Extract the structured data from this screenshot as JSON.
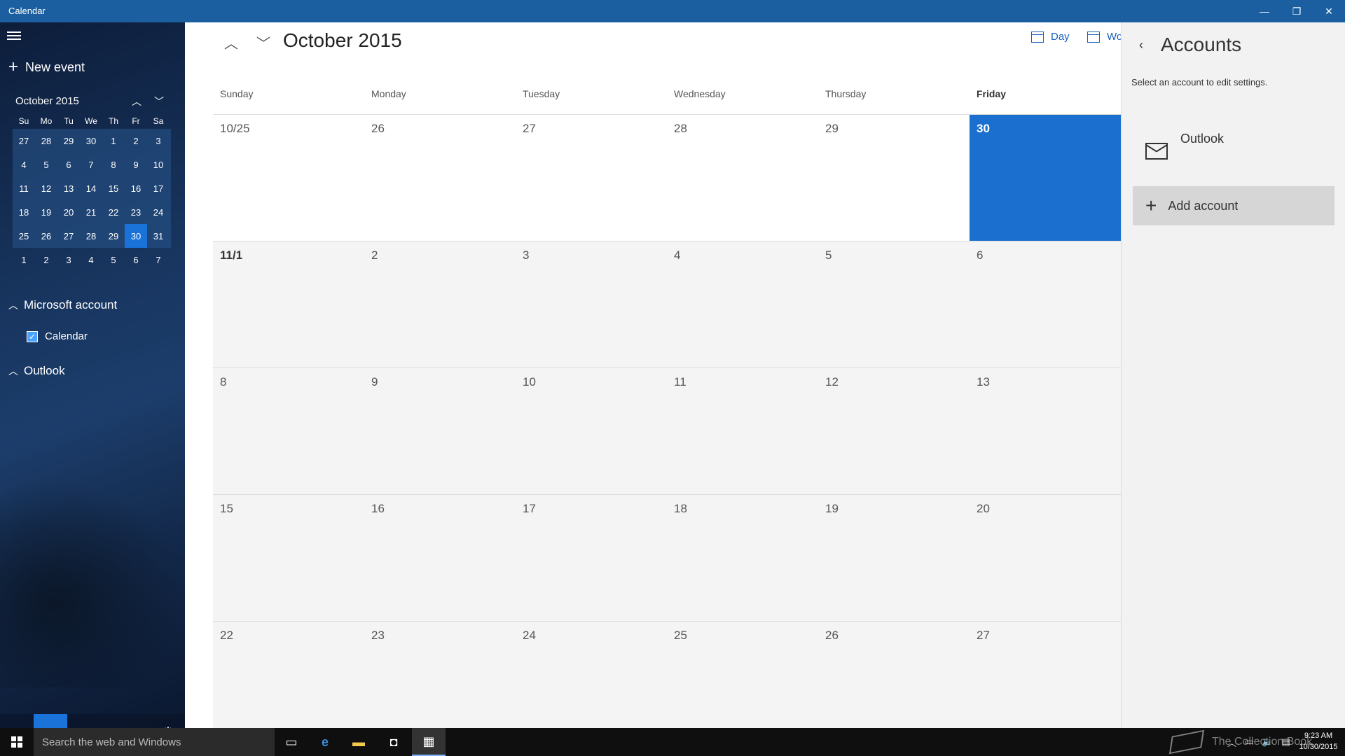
{
  "window": {
    "title": "Calendar",
    "minimize_glyph": "—",
    "maximize_glyph": "❐",
    "close_glyph": "✕"
  },
  "sidebar": {
    "new_event_label": "New event",
    "mini_calendar": {
      "month_label": "October 2015",
      "weekdays": [
        "Su",
        "Mo",
        "Tu",
        "We",
        "Th",
        "Fr",
        "Sa"
      ],
      "weeks": [
        [
          "27",
          "28",
          "29",
          "30",
          "1",
          "2",
          "3"
        ],
        [
          "4",
          "5",
          "6",
          "7",
          "8",
          "9",
          "10"
        ],
        [
          "11",
          "12",
          "13",
          "14",
          "15",
          "16",
          "17"
        ],
        [
          "18",
          "19",
          "20",
          "21",
          "22",
          "23",
          "24"
        ],
        [
          "25",
          "26",
          "27",
          "28",
          "29",
          "30",
          "31"
        ],
        [
          "1",
          "2",
          "3",
          "4",
          "5",
          "6",
          "7"
        ]
      ],
      "today": "30"
    },
    "groups": [
      {
        "label": "Microsoft account",
        "calendars": [
          {
            "label": "Calendar",
            "checked": true
          }
        ]
      },
      {
        "label": "Outlook",
        "calendars": []
      }
    ],
    "bottom_buttons": [
      "mail-icon",
      "calendar-icon",
      "smiley-icon",
      "gear-icon"
    ]
  },
  "main": {
    "month_title": "October 2015",
    "views": [
      {
        "label": "Day",
        "icon": "calendar-day-icon"
      },
      {
        "label": "Wor",
        "icon": "calendar-workweek-icon"
      }
    ],
    "weekdays": [
      "Sunday",
      "Monday",
      "Tuesday",
      "Wednesday",
      "Thursday",
      "Friday"
    ],
    "weeks": [
      [
        "10/25",
        "26",
        "27",
        "28",
        "29",
        "30"
      ],
      [
        "11/1",
        "2",
        "3",
        "4",
        "5",
        "6"
      ],
      [
        "8",
        "9",
        "10",
        "11",
        "12",
        "13"
      ],
      [
        "15",
        "16",
        "17",
        "18",
        "19",
        "20"
      ],
      [
        "22",
        "23",
        "24",
        "25",
        "26",
        "27"
      ]
    ]
  },
  "accounts_pane": {
    "title": "Accounts",
    "subtitle": "Select an account to edit settings.",
    "accounts": [
      {
        "name": "Outlook",
        "icon": "mail-icon"
      }
    ],
    "add_account_label": "Add account"
  },
  "taskbar": {
    "search_placeholder": "Search the web and Windows",
    "watermark_text": "The Collection Book",
    "clock_time": "9:23 AM",
    "clock_date": "10/30/2015",
    "accent": "#1a73d9"
  }
}
